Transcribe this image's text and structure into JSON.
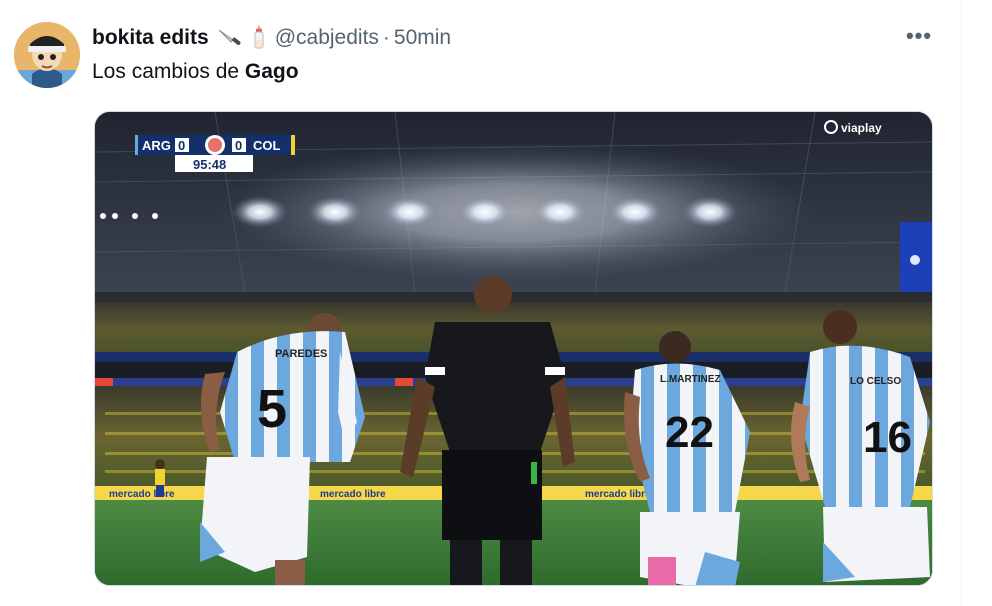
{
  "tweet": {
    "author": {
      "display_name": "bokita edits",
      "emojis": [
        "knife-emoji",
        "baby-bottle-emoji"
      ],
      "handle": "@cabjedits",
      "separator": "·",
      "time": "50min"
    },
    "text_prefix": "Los cambios de ",
    "text_bold": "Gago",
    "more_label": "•••"
  },
  "media": {
    "broadcaster": "viaplay",
    "scoreboard": {
      "home_team": "ARG",
      "home_score": "0",
      "away_team": "COL",
      "away_score": "0",
      "clock": "95:48"
    },
    "players": [
      {
        "name": "PAREDES",
        "number": "5"
      },
      {
        "name": "L.MARTINEZ",
        "number": "22"
      },
      {
        "name": "LO CELSO",
        "number": "16"
      }
    ],
    "ads": [
      "mercado libre",
      "mercado libre",
      "mercado libre"
    ]
  },
  "colors": {
    "text_primary": "#0f1419",
    "text_secondary": "#536471",
    "border": "#cfd9de",
    "argentina_blue": "#6ca8dd",
    "pitch_green": "#3d7a3a"
  }
}
